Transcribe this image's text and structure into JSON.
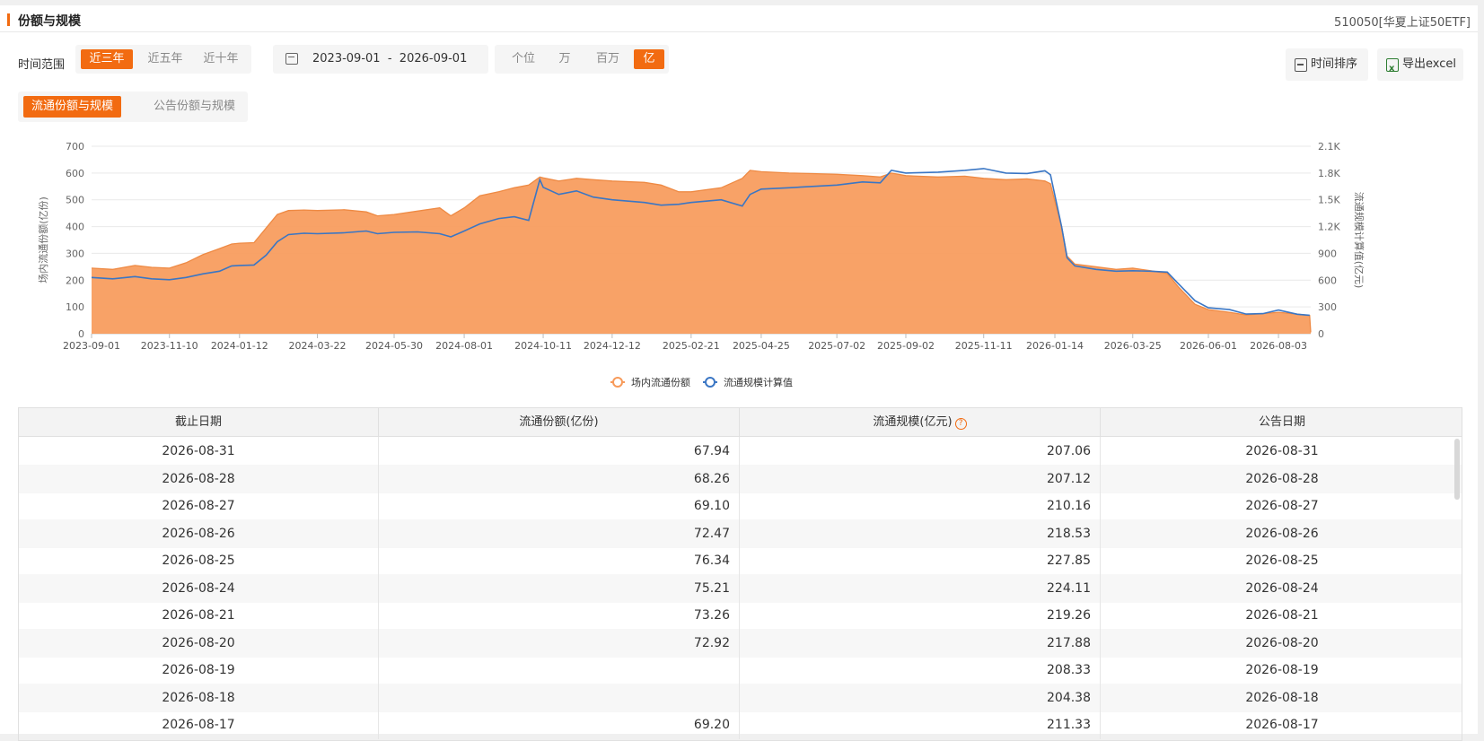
{
  "header": {
    "title": "份额与规模",
    "fund_code": "510050[华夏上证50ETF]"
  },
  "toolbar": {
    "range_label": "时间范围",
    "range_options": [
      "近三年",
      "近五年",
      "近十年"
    ],
    "range_selected": "近三年",
    "date_start": "2023-09-01",
    "date_sep": "-",
    "date_end": "2026-09-01",
    "unit_options": [
      "个位",
      "万",
      "百万",
      "亿"
    ],
    "unit_selected": "亿",
    "sort_button": "时间排序",
    "export_button": "导出excel"
  },
  "tabs": {
    "circulating": "流通份额与规模",
    "announced": "公告份额与规模",
    "selected": "流通份额与规模"
  },
  "chart_data": {
    "type": "area",
    "ylabel_left": "场内流通份额(亿份)",
    "ylabel_right": "流通规模计算值(亿元)",
    "y_left_ticks": [
      "0",
      "100",
      "200",
      "300",
      "400",
      "500",
      "600",
      "700"
    ],
    "y_right_ticks": [
      "0",
      "300",
      "600",
      "900",
      "1.2K",
      "1.5K",
      "1.8K",
      "2.1K"
    ],
    "ylim_left": [
      0,
      700
    ],
    "ylim_right": [
      0,
      2100
    ],
    "x_ticks": [
      "2023-09-01",
      "2023-11-10",
      "2024-01-12",
      "2024-03-22",
      "2024-05-30",
      "2024-08-01",
      "2024-10-11",
      "2024-12-12",
      "2025-02-21",
      "2025-04-25",
      "2025-07-02",
      "2025-09-02",
      "2025-11-11",
      "2026-01-14",
      "2026-03-25",
      "2026-06-01",
      "2026-08-03"
    ],
    "legend": "bottom-center",
    "series": [
      {
        "name": "场内流通份额",
        "axis": "left",
        "color": "#f79a5a",
        "points": [
          [
            "2023-09-01",
            245
          ],
          [
            "2023-09-20",
            240
          ],
          [
            "2023-10-10",
            255
          ],
          [
            "2023-10-25",
            248
          ],
          [
            "2023-11-10",
            245
          ],
          [
            "2023-11-25",
            265
          ],
          [
            "2023-12-10",
            295
          ],
          [
            "2023-12-25",
            318
          ],
          [
            "2024-01-05",
            335
          ],
          [
            "2024-01-12",
            338
          ],
          [
            "2024-01-25",
            340
          ],
          [
            "2024-02-05",
            395
          ],
          [
            "2024-02-15",
            445
          ],
          [
            "2024-02-25",
            460
          ],
          [
            "2024-03-10",
            462
          ],
          [
            "2024-03-22",
            460
          ],
          [
            "2024-04-15",
            463
          ],
          [
            "2024-05-05",
            455
          ],
          [
            "2024-05-15",
            440
          ],
          [
            "2024-05-30",
            445
          ],
          [
            "2024-06-20",
            458
          ],
          [
            "2024-07-10",
            470
          ],
          [
            "2024-07-20",
            440
          ],
          [
            "2024-08-01",
            470
          ],
          [
            "2024-08-15",
            515
          ],
          [
            "2024-09-01",
            530
          ],
          [
            "2024-09-15",
            545
          ],
          [
            "2024-09-28",
            555
          ],
          [
            "2024-10-08",
            585
          ],
          [
            "2024-10-11",
            582
          ],
          [
            "2024-10-25",
            570
          ],
          [
            "2024-11-10",
            580
          ],
          [
            "2024-11-25",
            575
          ],
          [
            "2024-12-12",
            570
          ],
          [
            "2025-01-10",
            565
          ],
          [
            "2025-01-25",
            555
          ],
          [
            "2025-02-10",
            530
          ],
          [
            "2025-02-21",
            530
          ],
          [
            "2025-03-20",
            545
          ],
          [
            "2025-04-08",
            580
          ],
          [
            "2025-04-15",
            610
          ],
          [
            "2025-04-25",
            605
          ],
          [
            "2025-05-20",
            600
          ],
          [
            "2025-06-10",
            598
          ],
          [
            "2025-07-02",
            595
          ],
          [
            "2025-07-25",
            590
          ],
          [
            "2025-08-10",
            585
          ],
          [
            "2025-08-20",
            600
          ],
          [
            "2025-09-02",
            590
          ],
          [
            "2025-10-01",
            585
          ],
          [
            "2025-10-25",
            588
          ],
          [
            "2025-11-11",
            580
          ],
          [
            "2025-12-01",
            575
          ],
          [
            "2025-12-20",
            578
          ],
          [
            "2026-01-05",
            570
          ],
          [
            "2026-01-10",
            560
          ],
          [
            "2026-01-14",
            495
          ],
          [
            "2026-01-20",
            400
          ],
          [
            "2026-01-25",
            290
          ],
          [
            "2026-02-01",
            260
          ],
          [
            "2026-02-20",
            250
          ],
          [
            "2026-03-10",
            240
          ],
          [
            "2026-03-25",
            245
          ],
          [
            "2026-04-10",
            235
          ],
          [
            "2026-04-25",
            225
          ],
          [
            "2026-05-05",
            175
          ],
          [
            "2026-05-20",
            110
          ],
          [
            "2026-06-01",
            90
          ],
          [
            "2026-06-20",
            80
          ],
          [
            "2026-07-05",
            70
          ],
          [
            "2026-07-20",
            75
          ],
          [
            "2026-08-03",
            80
          ],
          [
            "2026-08-20",
            72.92
          ],
          [
            "2026-08-31",
            67.94
          ],
          [
            "2026-09-01",
            5
          ]
        ]
      },
      {
        "name": "流通规模计算值",
        "axis": "right",
        "color": "#3a76c4",
        "points": [
          [
            "2023-09-01",
            630
          ],
          [
            "2023-09-20",
            615
          ],
          [
            "2023-10-10",
            640
          ],
          [
            "2023-10-25",
            615
          ],
          [
            "2023-11-10",
            605
          ],
          [
            "2023-11-25",
            630
          ],
          [
            "2023-12-10",
            670
          ],
          [
            "2023-12-25",
            700
          ],
          [
            "2024-01-05",
            760
          ],
          [
            "2024-01-12",
            765
          ],
          [
            "2024-01-25",
            770
          ],
          [
            "2024-02-05",
            880
          ],
          [
            "2024-02-15",
            1030
          ],
          [
            "2024-02-25",
            1110
          ],
          [
            "2024-03-10",
            1125
          ],
          [
            "2024-03-22",
            1120
          ],
          [
            "2024-04-15",
            1130
          ],
          [
            "2024-05-05",
            1150
          ],
          [
            "2024-05-15",
            1120
          ],
          [
            "2024-05-30",
            1135
          ],
          [
            "2024-06-20",
            1140
          ],
          [
            "2024-07-10",
            1120
          ],
          [
            "2024-07-20",
            1085
          ],
          [
            "2024-08-01",
            1150
          ],
          [
            "2024-08-15",
            1230
          ],
          [
            "2024-09-01",
            1290
          ],
          [
            "2024-09-15",
            1310
          ],
          [
            "2024-09-28",
            1270
          ],
          [
            "2024-10-08",
            1725
          ],
          [
            "2024-10-11",
            1640
          ],
          [
            "2024-10-25",
            1560
          ],
          [
            "2024-11-10",
            1600
          ],
          [
            "2024-11-25",
            1530
          ],
          [
            "2024-12-12",
            1500
          ],
          [
            "2025-01-10",
            1470
          ],
          [
            "2025-01-25",
            1440
          ],
          [
            "2025-02-10",
            1450
          ],
          [
            "2025-02-21",
            1470
          ],
          [
            "2025-03-20",
            1500
          ],
          [
            "2025-04-08",
            1430
          ],
          [
            "2025-04-15",
            1560
          ],
          [
            "2025-04-25",
            1620
          ],
          [
            "2025-05-20",
            1635
          ],
          [
            "2025-06-10",
            1650
          ],
          [
            "2025-07-02",
            1665
          ],
          [
            "2025-07-25",
            1700
          ],
          [
            "2025-08-10",
            1690
          ],
          [
            "2025-08-20",
            1830
          ],
          [
            "2025-09-02",
            1800
          ],
          [
            "2025-10-01",
            1810
          ],
          [
            "2025-10-25",
            1830
          ],
          [
            "2025-11-11",
            1850
          ],
          [
            "2025-12-01",
            1800
          ],
          [
            "2025-12-20",
            1795
          ],
          [
            "2026-01-05",
            1825
          ],
          [
            "2026-01-10",
            1780
          ],
          [
            "2026-01-14",
            1550
          ],
          [
            "2026-01-20",
            1200
          ],
          [
            "2026-01-25",
            850
          ],
          [
            "2026-02-01",
            760
          ],
          [
            "2026-02-20",
            720
          ],
          [
            "2026-03-10",
            700
          ],
          [
            "2026-03-25",
            705
          ],
          [
            "2026-04-10",
            700
          ],
          [
            "2026-04-25",
            690
          ],
          [
            "2026-05-05",
            560
          ],
          [
            "2026-05-20",
            370
          ],
          [
            "2026-06-01",
            290
          ],
          [
            "2026-06-20",
            270
          ],
          [
            "2026-07-05",
            220
          ],
          [
            "2026-07-20",
            225
          ],
          [
            "2026-08-03",
            265
          ],
          [
            "2026-08-20",
            217.88
          ],
          [
            "2026-08-31",
            207.06
          ]
        ]
      }
    ]
  },
  "table": {
    "headers": [
      "截止日期",
      "流通份额(亿份)",
      "流通规模(亿元)",
      "公告日期"
    ],
    "rows": [
      [
        "2026-08-31",
        "67.94",
        "207.06",
        "2026-08-31"
      ],
      [
        "2026-08-28",
        "68.26",
        "207.12",
        "2026-08-28"
      ],
      [
        "2026-08-27",
        "69.10",
        "210.16",
        "2026-08-27"
      ],
      [
        "2026-08-26",
        "72.47",
        "218.53",
        "2026-08-26"
      ],
      [
        "2026-08-25",
        "76.34",
        "227.85",
        "2026-08-25"
      ],
      [
        "2026-08-24",
        "75.21",
        "224.11",
        "2026-08-24"
      ],
      [
        "2026-08-21",
        "73.26",
        "219.26",
        "2026-08-21"
      ],
      [
        "2026-08-20",
        "72.92",
        "217.88",
        "2026-08-20"
      ],
      [
        "2026-08-19",
        "",
        "208.33",
        "2026-08-19"
      ],
      [
        "2026-08-18",
        "",
        "204.38",
        "2026-08-18"
      ],
      [
        "2026-08-17",
        "69.20",
        "211.33",
        "2026-08-17"
      ]
    ]
  }
}
